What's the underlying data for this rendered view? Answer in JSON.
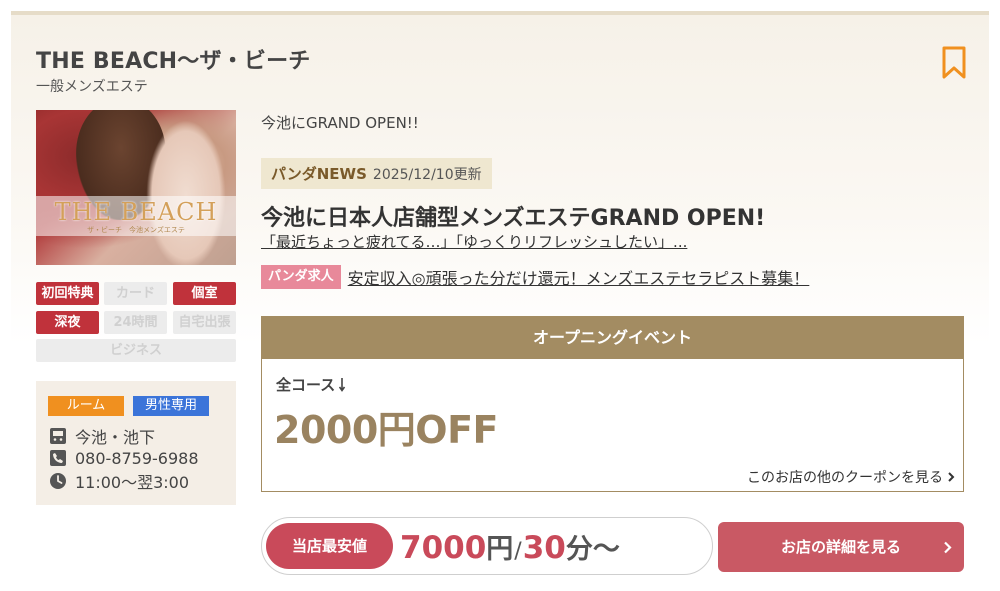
{
  "shop": {
    "name": "THE BEACH〜ザ・ビーチ",
    "genre": "一般メンズエステ",
    "photo_logo": "THE BEACH",
    "photo_logo_sub": "ザ・ビーチ　今池メンズエステ"
  },
  "tags": [
    {
      "label": "初回特典",
      "active": true
    },
    {
      "label": "カード",
      "active": false
    },
    {
      "label": "個室",
      "active": true
    },
    {
      "label": "深夜",
      "active": true
    },
    {
      "label": "24時間",
      "active": false
    },
    {
      "label": "自宅出張",
      "active": false
    },
    {
      "label": "ビジネス",
      "active": false
    }
  ],
  "info": {
    "badge_room": "ルーム",
    "badge_male": "男性専用",
    "station": "今池・池下",
    "phone": "080-8759-6988",
    "hours": "11:00〜翌3:00"
  },
  "catch_copy": "今池にGRAND OPEN!!",
  "news": {
    "label": "パンダNEWS",
    "date": "2025/12/10更新",
    "title": "今池に日本人店舗型メンズエステGRAND OPEN!",
    "link": "「最近ちょっと疲れてる…」「ゆっくりリフレッシュしたい」..."
  },
  "job": {
    "label": "パンダ求人",
    "link": "安定収入◎頑張った分だけ還元！メンズエステセラピスト募集！"
  },
  "coupon": {
    "header": "オープニングイベント",
    "course": "全コース",
    "amount": "2000円OFF",
    "more_link": "このお店の他のクーポンを見る"
  },
  "price": {
    "label": "当店最安値",
    "amount": "7000",
    "yen": "円",
    "slash": "/",
    "minutes": "30",
    "minutes_unit": "分〜"
  },
  "detail_button": "お店の詳細を見る",
  "colors": {
    "accent_red": "#c0323b",
    "brand_gold": "#a38c62",
    "bookmark_orange": "#f0901f",
    "price_red": "#c94a5a"
  }
}
